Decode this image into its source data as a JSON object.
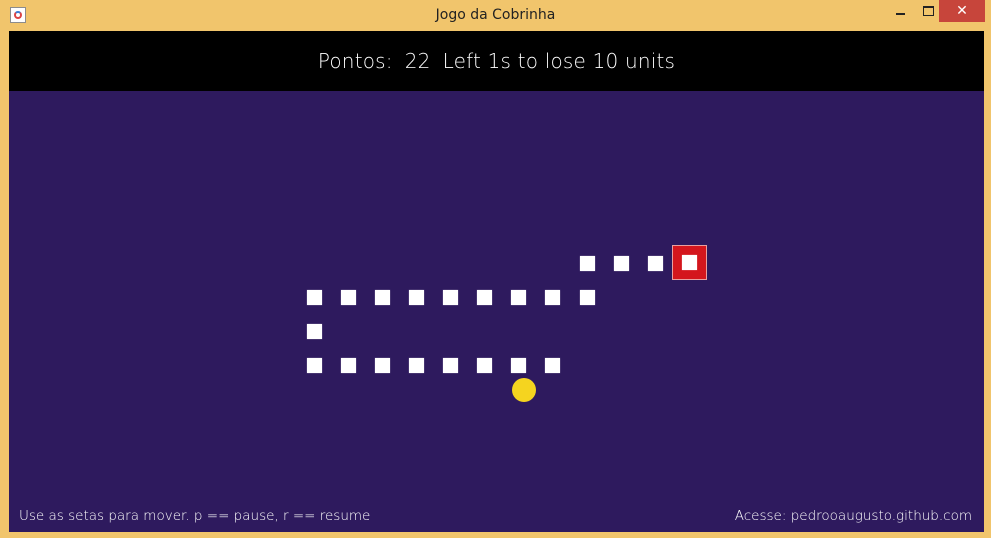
{
  "window": {
    "title": "Jogo da Cobrinha",
    "controls": {
      "minimize": "minimize",
      "maximize": "maximize",
      "close": "✕"
    }
  },
  "hud": {
    "points_label": "Pontos:",
    "points_value": "22",
    "timer_text": "Left 1s to lose 10 units"
  },
  "game": {
    "colors": {
      "background": "#2e1a5e",
      "hud_background": "#000000",
      "snake_segment": "#ffffff",
      "head_highlight": "#d4161d",
      "food": "#f5d41f"
    }
  },
  "footer": {
    "instructions": "Use as setas para mover. p == pause, r == resume",
    "link": "Acesse: pedrooaugusto.github.com"
  }
}
